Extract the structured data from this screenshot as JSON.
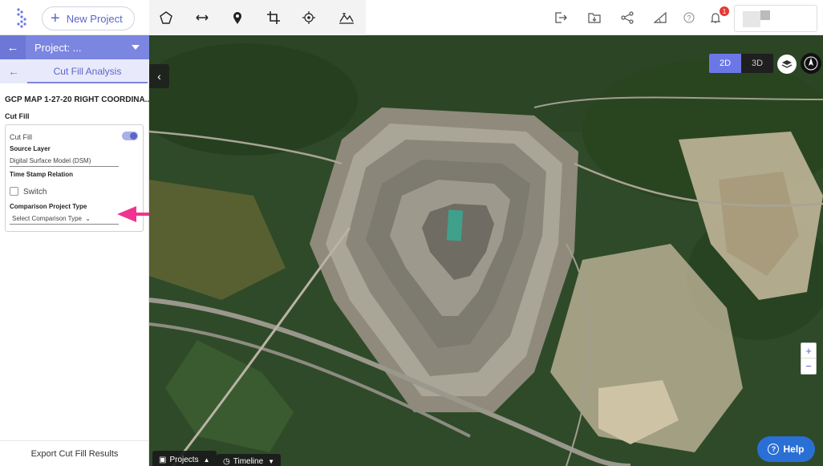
{
  "header": {
    "new_project_label": "New Project",
    "notification_count": "1",
    "tools": [
      "polygon-icon",
      "measure-distance-icon",
      "location-pin-icon",
      "crop-icon",
      "target-icon",
      "elevation-profile-icon"
    ],
    "right_tools": [
      "export-icon",
      "download-icon",
      "share-icon",
      "slope-icon",
      "help-circle-icon",
      "bell-icon"
    ]
  },
  "sidebar": {
    "project_title": "Project: ...",
    "sub_title": "Cut Fill Analysis",
    "map_name": "GCP MAP 1-27-20 RIGHT COORDINA...",
    "section_title": "Cut Fill",
    "card": {
      "cut_fill_label": "Cut Fill",
      "cut_fill_enabled": true,
      "source_layer_heading": "Source Layer",
      "source_layer_value": "Digital Surface Model (DSM)",
      "time_stamp_heading": "Time Stamp Relation",
      "switch_label": "Switch",
      "switch_checked": false,
      "comparison_heading": "Comparison Project Type",
      "comparison_placeholder": "Select Comparison Type"
    },
    "export_label": "Export Cut Fill Results"
  },
  "map": {
    "view_2d": "2D",
    "view_3d": "3D",
    "active_view": "2D",
    "zoom_in": "+",
    "zoom_out": "−",
    "help_label": "Help",
    "projects_tab": "Projects",
    "timeline_tab": "Timeline"
  },
  "colors": {
    "accent": "#7b86e0",
    "accent_dark": "#5b66c9",
    "annotation_arrow": "#f0348f",
    "help_button": "#2a6fd6"
  }
}
